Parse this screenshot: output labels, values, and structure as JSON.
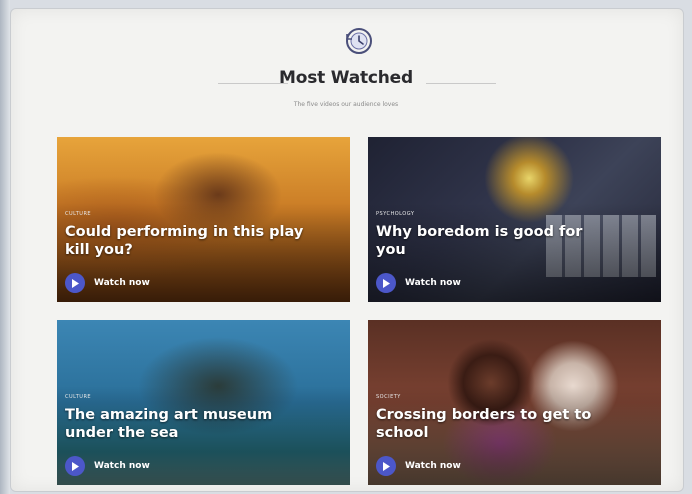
{
  "page": {
    "title": "Most Watched",
    "subtitle": "The five videos our audience loves"
  },
  "icons": {
    "header": "history-clock-icon",
    "play": "play-icon"
  },
  "colors": {
    "play_button": "#4c57c9",
    "title_text": "#2a2a2e",
    "background": "#f3f3f1"
  },
  "cards": [
    {
      "tag": "Culture",
      "headline": "Could performing in this play kill you?",
      "watch_label": "Watch now"
    },
    {
      "tag": "Psychology",
      "headline": "Why boredom is good for you",
      "watch_label": "Watch now"
    },
    {
      "tag": "Culture",
      "headline": "The amazing art museum under the sea",
      "watch_label": "Watch now"
    },
    {
      "tag": "Society",
      "headline": "Crossing borders to get to school",
      "watch_label": "Watch now"
    }
  ]
}
